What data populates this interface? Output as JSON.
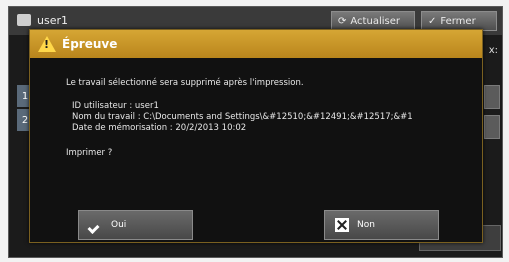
{
  "background": {
    "user_label": "user1",
    "refresh_label": "Actualiser",
    "close_label": "Fermer",
    "side_items": [
      "1",
      "2"
    ]
  },
  "dialog": {
    "title": "Épreuve",
    "message": "Le travail sélectionné sera supprimé après l'impression.",
    "details": [
      "ID utilisateur : user1",
      "Nom du travail : C:\\Documents and Settings\\&#12510;&#12491;&#12517;&#1",
      "Date de mémorisation : 20/2/2013 10:02"
    ],
    "question": "Imprimer ?",
    "yes_label": "Oui",
    "no_label": "Non"
  }
}
